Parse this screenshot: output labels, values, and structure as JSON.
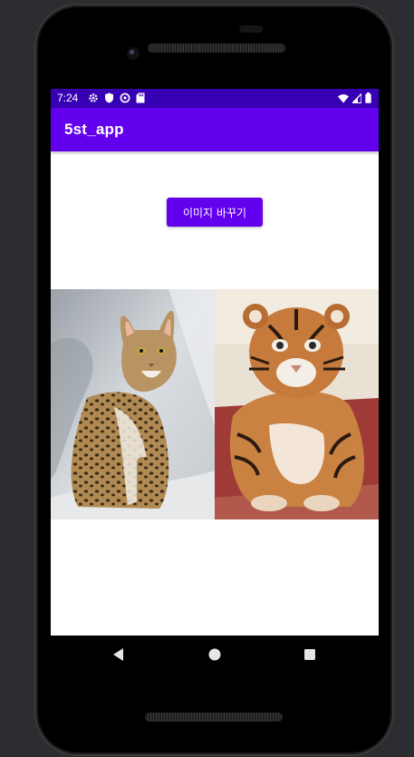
{
  "status_bar": {
    "time": "7:24",
    "left_icons": [
      "gear-icon",
      "shield-icon",
      "data-saver-icon",
      "sd-card-icon"
    ],
    "right_icons": [
      "wifi-icon",
      "signal-icon",
      "battery-icon"
    ]
  },
  "app_bar": {
    "title": "5st_app"
  },
  "main": {
    "button_label": "이미지 바꾸기",
    "images": [
      {
        "subject": "cat",
        "icon": "cat-photo"
      },
      {
        "subject": "tiger",
        "icon": "tiger-cub-photo"
      }
    ]
  },
  "nav_bar": {
    "buttons": [
      "back-icon",
      "home-icon",
      "recents-icon"
    ]
  },
  "colors": {
    "primary": "#6200ee",
    "primary_dark": "#3700b3"
  }
}
